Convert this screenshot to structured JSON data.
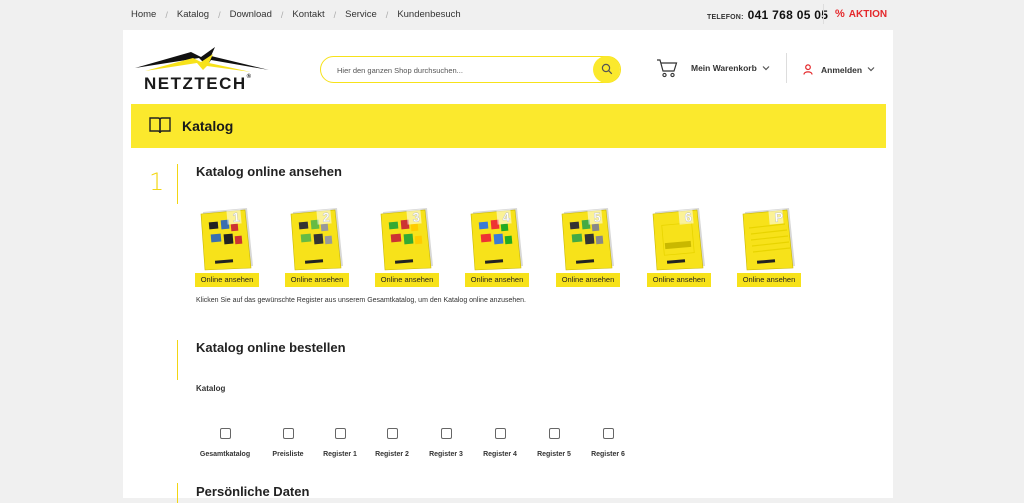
{
  "topnav": {
    "items": [
      {
        "label": "Home"
      },
      {
        "label": "Katalog"
      },
      {
        "label": "Download"
      },
      {
        "label": "Kontakt"
      },
      {
        "label": "Service"
      },
      {
        "label": "Kundenbesuch"
      }
    ],
    "separator": "/",
    "phone_label": "TELEFON:",
    "phone_number": "041 768 05 05",
    "aktion_icon": "%",
    "aktion_label": "AKTION"
  },
  "header": {
    "logo_text": "NETZTECH",
    "logo_reg": "®",
    "search_placeholder": "Hier den ganzen Shop durchsuchen...",
    "search_icon": "search-icon",
    "cart_label": "Mein Warenkorb",
    "cart_icon": "cart-icon",
    "login_label": "Anmelden",
    "login_icon": "user-icon"
  },
  "page": {
    "title": "Katalog",
    "title_icon": "book-icon"
  },
  "section1": {
    "step": "1",
    "title": "Katalog online ansehen",
    "catalogs": [
      {
        "register": "1",
        "button": "Online ansehen"
      },
      {
        "register": "2",
        "button": "Online ansehen"
      },
      {
        "register": "3",
        "button": "Online ansehen"
      },
      {
        "register": "4",
        "button": "Online ansehen"
      },
      {
        "register": "5",
        "button": "Online ansehen"
      },
      {
        "register": "6",
        "button": "Online ansehen"
      },
      {
        "register": "P",
        "button": "Online ansehen"
      }
    ],
    "info": "Klicken Sie auf das gewünschte Register aus unserem Gesamtkatalog, um den Katalog online anzusehen."
  },
  "section2": {
    "title": "Katalog online bestellen",
    "katalog_label": "Katalog",
    "options": [
      {
        "label": "Gesamtkatalog",
        "checked": false
      },
      {
        "label": "Preisliste",
        "checked": false
      },
      {
        "label": "Register 1",
        "checked": false
      },
      {
        "label": "Register 2",
        "checked": false
      },
      {
        "label": "Register 3",
        "checked": false
      },
      {
        "label": "Register 4",
        "checked": false
      },
      {
        "label": "Register 5",
        "checked": false
      },
      {
        "label": "Register 6",
        "checked": false
      }
    ]
  },
  "section3": {
    "title": "Persönliche Daten"
  },
  "colors": {
    "brand_yellow": "#fbe92d",
    "aktion_red": "#e4282b"
  }
}
